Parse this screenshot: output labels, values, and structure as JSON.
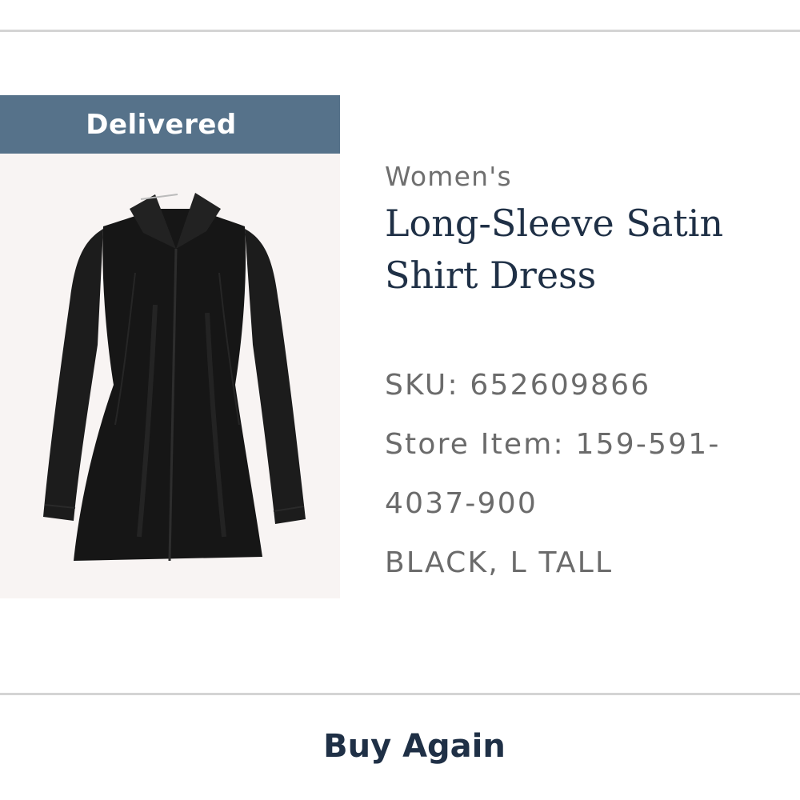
{
  "order_item": {
    "status": "Delivered",
    "category": "Women's",
    "title": "Long-Sleeve Satin Shirt Dress",
    "sku_line": "SKU: 652609866",
    "store_item_line_1": "Store Item: 159-591-",
    "store_item_line_2": "4037-900",
    "color_size_line": "BLACK, L TALL",
    "image": "black-satin-shirt-dress-photo"
  },
  "actions": {
    "buy_again_label": "Buy Again"
  },
  "colors": {
    "status_banner": "#56728a",
    "title_text": "#1f3046",
    "detail_text": "#6b6b6b",
    "divider": "#d4d4d4"
  }
}
